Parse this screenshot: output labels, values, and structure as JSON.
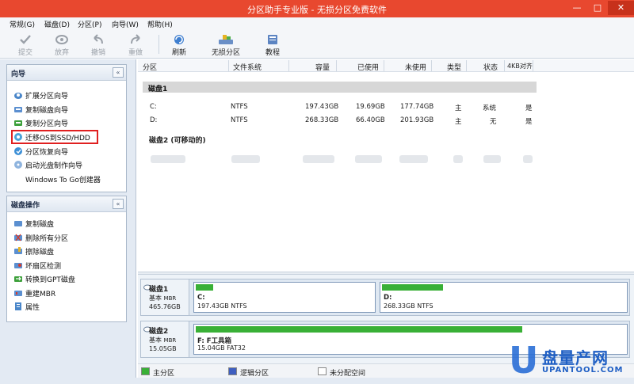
{
  "window": {
    "title": "分区助手专业版 - 无损分区免费软件",
    "minimize": "—",
    "maximize": "□",
    "close": "✕"
  },
  "menu": [
    "常规(G)",
    "磁盘(D)",
    "分区(P)",
    "向导(W)",
    "帮助(H)"
  ],
  "toolbar": {
    "submit": "提交",
    "discard": "放弃",
    "undo": "撤销",
    "redo": "重做",
    "refresh": "刷新",
    "lossless": "无损分区",
    "tutorial": "教程"
  },
  "wizard_panel": {
    "title": "向导",
    "collapse": "«",
    "items": [
      "扩展分区向导",
      "复制磁盘向导",
      "复制分区向导",
      "迁移OS到SSD/HDD",
      "分区恢复向导",
      "启动光盘制作向导",
      "Windows To Go创建器"
    ]
  },
  "disk_ops_panel": {
    "title": "磁盘操作",
    "collapse": "«",
    "items": [
      "复制磁盘",
      "删除所有分区",
      "擦除磁盘",
      "坏扇区检测",
      "转换到GPT磁盘",
      "重建MBR",
      "属性"
    ]
  },
  "list": {
    "columns": [
      "分区",
      "文件系统",
      "容量",
      "已使用",
      "未使用",
      "类型",
      "状态",
      "4KB对齐"
    ],
    "disk1_label": "磁盘1",
    "disk1_rows": [
      {
        "part": "C:",
        "fs": "NTFS",
        "cap": "197.43GB",
        "used": "19.69GB",
        "free": "177.74GB",
        "type": "主",
        "status": "系统",
        "align": "是"
      },
      {
        "part": "D:",
        "fs": "NTFS",
        "cap": "268.33GB",
        "used": "66.40GB",
        "free": "201.93GB",
        "type": "主",
        "status": "无",
        "align": "是"
      }
    ],
    "disk2_label": "磁盘2 (可移动的)"
  },
  "disk_map": {
    "disk1": {
      "name": "磁盘1",
      "type": "基本",
      "mbr": "MBR",
      "size": "465.76GB",
      "partitions": [
        {
          "name": "C:",
          "info": "197.43GB NTFS",
          "used_fraction": 0.1
        },
        {
          "name": "D:",
          "info": "268.33GB NTFS",
          "used_fraction": 0.25
        }
      ]
    },
    "disk2": {
      "name": "磁盘2",
      "type": "基本",
      "mbr": "MBR",
      "size": "15.05GB",
      "partitions": [
        {
          "name": "F: F工具箱",
          "info": "15.04GB FAT32",
          "used_fraction": 0.76
        }
      ]
    }
  },
  "legend": {
    "primary": "主分区",
    "logical": "逻辑分区",
    "unallocated": "未分配空间"
  },
  "watermark": {
    "letter": "U",
    "top": "盘量产网",
    "bottom": "UPANTOOL.COM"
  },
  "colors": {
    "titlebar": "#e8482f",
    "primary_partition": "#39b036",
    "logical_partition": "#3f5fc0",
    "highlight": "#e02020"
  }
}
